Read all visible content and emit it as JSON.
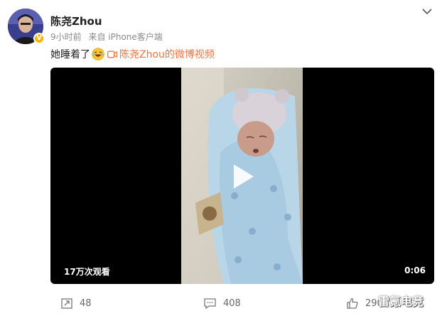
{
  "author": {
    "name": "陈尧Zhou",
    "verified": true
  },
  "post": {
    "time": "9小时前",
    "source": "来自 iPhone客户端",
    "text": "她睡着了",
    "video_link": "陈尧Zhou的微博视频"
  },
  "video": {
    "views": "17万次观看",
    "duration": "0:06"
  },
  "actions": {
    "reposts": "48",
    "comments": "408",
    "likes": "2902"
  },
  "watermark": "雷氪电竞",
  "colors": {
    "link": "#eb7340",
    "badge": "#f7b500"
  }
}
